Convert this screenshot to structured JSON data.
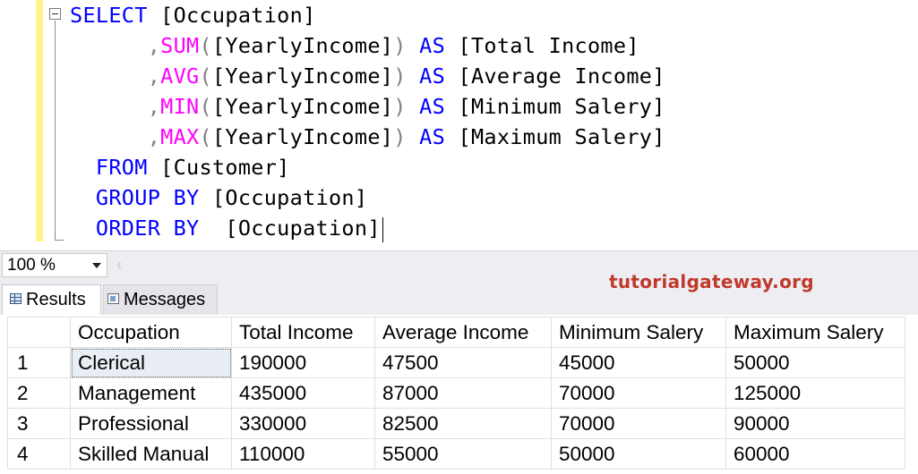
{
  "editor": {
    "lines": [
      [
        {
          "t": "SELECT ",
          "c": "kw"
        },
        {
          "t": "[Occupation]",
          "c": ""
        }
      ],
      [
        {
          "t": "      ,",
          "c": "op"
        },
        {
          "t": "SUM",
          "c": "fn"
        },
        {
          "t": "(",
          "c": "op"
        },
        {
          "t": "[YearlyIncome]",
          "c": ""
        },
        {
          "t": ") ",
          "c": "op"
        },
        {
          "t": "AS ",
          "c": "kw"
        },
        {
          "t": "[Total Income]",
          "c": ""
        }
      ],
      [
        {
          "t": "      ,",
          "c": "op"
        },
        {
          "t": "AVG",
          "c": "fn"
        },
        {
          "t": "(",
          "c": "op"
        },
        {
          "t": "[YearlyIncome]",
          "c": ""
        },
        {
          "t": ") ",
          "c": "op"
        },
        {
          "t": "AS ",
          "c": "kw"
        },
        {
          "t": "[Average Income]",
          "c": ""
        }
      ],
      [
        {
          "t": "      ,",
          "c": "op"
        },
        {
          "t": "MIN",
          "c": "fn"
        },
        {
          "t": "(",
          "c": "op"
        },
        {
          "t": "[YearlyIncome]",
          "c": ""
        },
        {
          "t": ") ",
          "c": "op"
        },
        {
          "t": "AS ",
          "c": "kw"
        },
        {
          "t": "[Minimum Salery]",
          "c": ""
        }
      ],
      [
        {
          "t": "      ,",
          "c": "op"
        },
        {
          "t": "MAX",
          "c": "fn"
        },
        {
          "t": "(",
          "c": "op"
        },
        {
          "t": "[YearlyIncome]",
          "c": ""
        },
        {
          "t": ") ",
          "c": "op"
        },
        {
          "t": "AS ",
          "c": "kw"
        },
        {
          "t": "[Maximum Salery]",
          "c": ""
        }
      ],
      [
        {
          "t": "  FROM ",
          "c": "kw"
        },
        {
          "t": "[Customer]",
          "c": ""
        }
      ],
      [
        {
          "t": "  GROUP BY ",
          "c": "kw"
        },
        {
          "t": "[Occupation]",
          "c": ""
        }
      ],
      [
        {
          "t": "  ORDER BY  ",
          "c": "kw"
        },
        {
          "t": "[Occupation]",
          "c": ""
        }
      ]
    ]
  },
  "zoom": {
    "value": "100 %"
  },
  "tabs": {
    "results": "Results",
    "messages": "Messages"
  },
  "watermark": "tutorialgateway.org",
  "grid": {
    "columns": [
      "",
      "Occupation",
      "Total Income",
      "Average Income",
      "Minimum Salery",
      "Maximum Salery"
    ],
    "rows": [
      [
        "1",
        "Clerical",
        "190000",
        "47500",
        "45000",
        "50000"
      ],
      [
        "2",
        "Management",
        "435000",
        "87000",
        "70000",
        "125000"
      ],
      [
        "3",
        "Professional",
        "330000",
        "82500",
        "70000",
        "90000"
      ],
      [
        "4",
        "Skilled Manual",
        "110000",
        "55000",
        "50000",
        "60000"
      ]
    ]
  }
}
